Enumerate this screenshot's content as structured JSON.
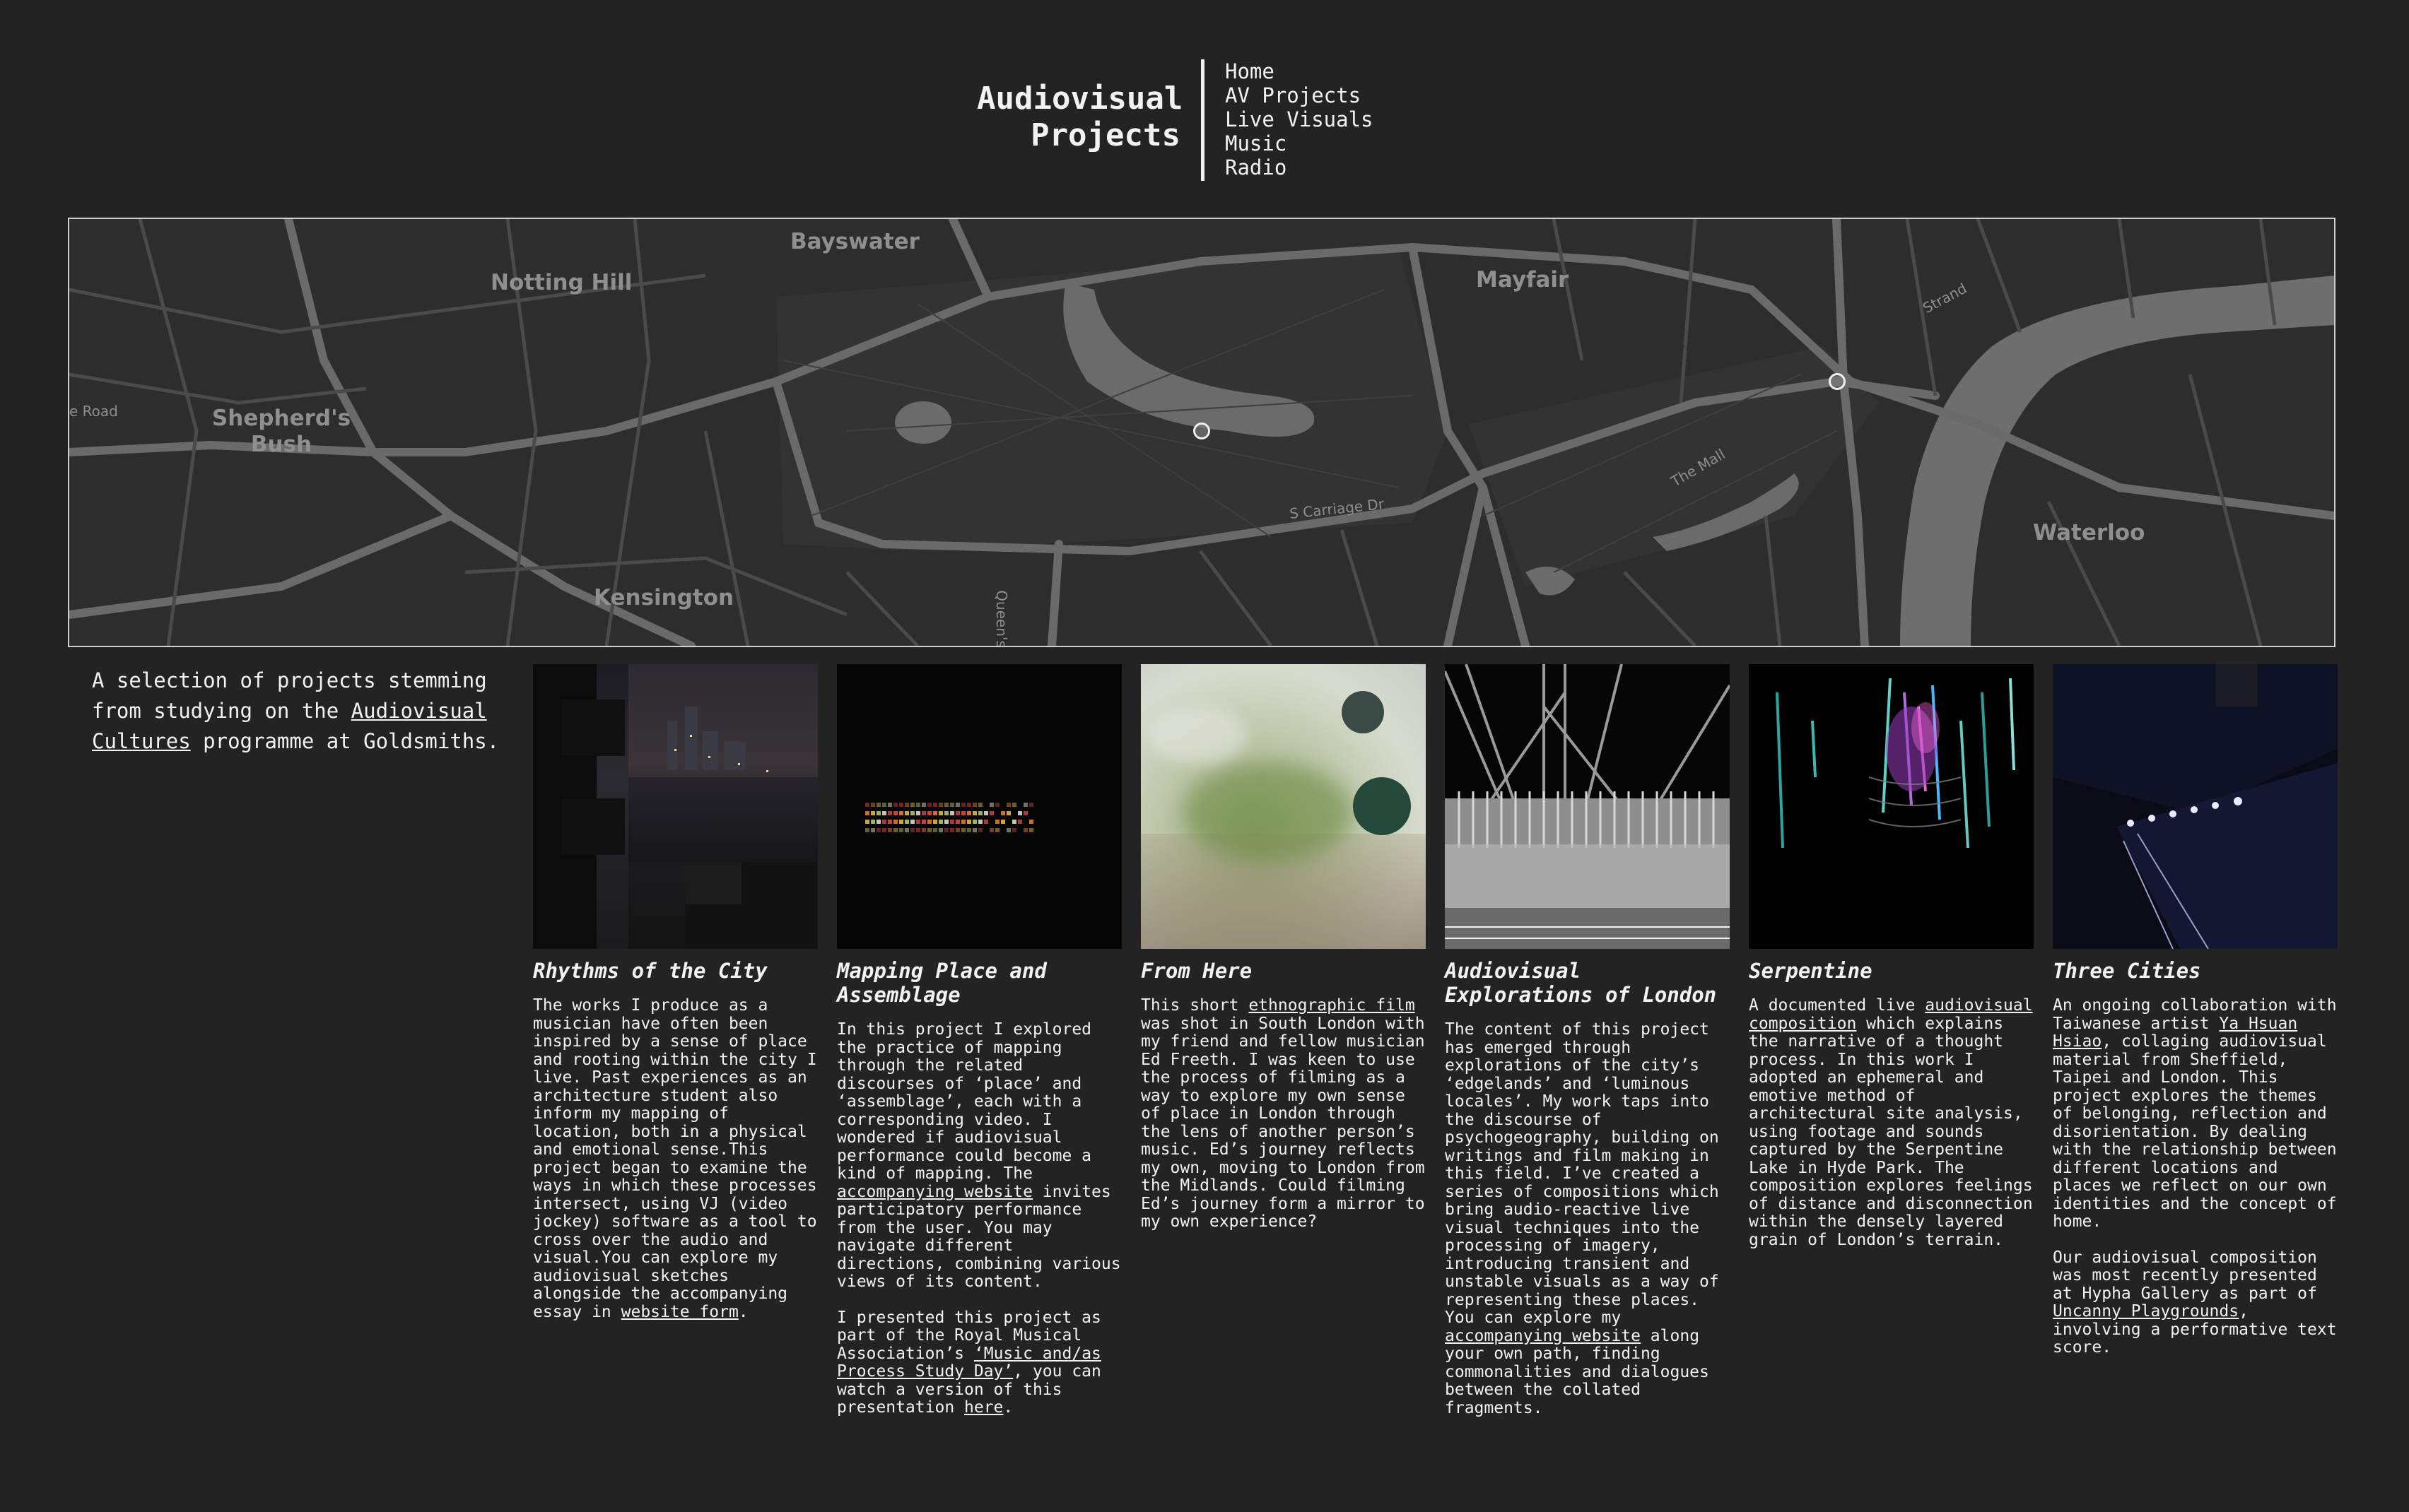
{
  "site": {
    "title_line1": "Audiovisual",
    "title_line2": "Projects"
  },
  "nav": {
    "items": [
      "Home",
      "AV Projects",
      "Live Visuals",
      "Music",
      "Radio"
    ]
  },
  "map": {
    "labels": [
      "Bayswater",
      "Notting Hill",
      "Mayfair",
      "Strand",
      "Shepherd's Bush",
      "Kensington",
      "Waterloo",
      "The Mall",
      "S Carriage Dr",
      "Queen's",
      "e Road"
    ]
  },
  "intro": {
    "text_before": "A selection of projects stemming from studying on the ",
    "link": "Audiovisual Cultures",
    "text_after": " programme at Goldsmiths."
  },
  "projects": [
    {
      "title": "Rhythms of the City",
      "p1_before": "The works I produce as a musician have often been inspired by a sense of place and rooting within the city I live. Past experiences as an architecture student also inform my mapping of location, both in a physical and emotional sense.This project began to examine the ways in which these processes intersect, using VJ (video jockey) software as a tool to cross over the audio and visual.You can explore my audiovisual sketches alongside the accompanying essay in ",
      "p1_link": "website form",
      "p1_after": "."
    },
    {
      "title": "Mapping Place and Assemblage",
      "p1_before": "In this project I explored the practice of mapping through the related discourses of ‘place’ and ‘assemblage’, each with a corresponding video. I wondered if audiovisual performance could become a kind of mapping. The ",
      "p1_link": "accompanying website",
      "p1_after": " invites participatory performance from the user. You may navigate different directions, combining various views of its content.",
      "p2_before": "I presented this project as part of the Royal Musical Association’s ",
      "p2_link": "‘Music and/as Process Study Day’",
      "p2_mid": ", you can watch a version of this presentation ",
      "p2_link2": "here",
      "p2_after": "."
    },
    {
      "title": "From Here",
      "p1_before": "This short ",
      "p1_link": "ethnographic film",
      "p1_after": " was shot in South London with my friend and fellow musician Ed Freeth. I was keen to use the process of filming as a way to explore my own sense of place in London through the lens of another person’s music. Ed’s journey reflects my own, moving to London from the Midlands. Could filming Ed’s journey form a mirror to my own experience?"
    },
    {
      "title": "Audiovisual Explorations of London",
      "p1_before": "The content of this project has emerged through explorations of the city’s ‘edgelands’ and ‘luminous locales’. My work taps into the discourse of psychogeography, building on writings and film making in this field. I’ve created a series of compositions which bring audio-reactive live visual techniques into the processing of imagery, introducing transient and unstable visuals as a way of representing these places. You can explore my ",
      "p1_link": "accompanying website",
      "p1_after": " along your own path, finding commonalities and dialogues between the collated fragments."
    },
    {
      "title": "Serpentine",
      "p1_before": "A documented live ",
      "p1_link": "audiovisual composition",
      "p1_after": " which explains the narrative of a thought process. In this work I adopted an ephemeral and emotive method of architectural site analysis, using footage and sounds captured by the Serpentine Lake in Hyde Park. The composition explores feelings of distance and disconnection within the densely layered grain of London’s terrain."
    },
    {
      "title": "Three Cities",
      "p1_before": "An ongoing collaboration with Taiwanese artist ",
      "p1_link": "Ya Hsuan Hsiao",
      "p1_after": ", collaging audiovisual material from Sheffield, Taipei and London. This project explores the themes of belonging, reflection and disorientation. By dealing with the relationship between different locations and places we reflect on our own identities and the concept of home.",
      "p2_before": "Our audiovisual composition was most recently presented at Hypha Gallery as part of ",
      "p2_link": "Uncanny Playgrounds",
      "p2_after": ", involving a performative text score."
    }
  ]
}
